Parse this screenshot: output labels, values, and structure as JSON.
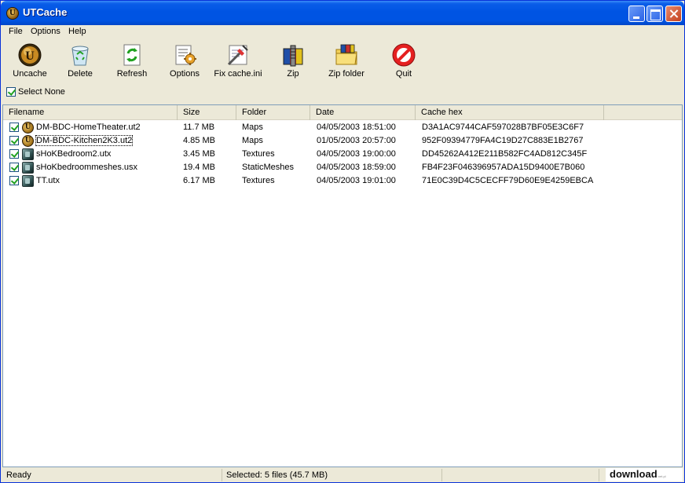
{
  "window": {
    "title": "UTCache"
  },
  "menu": [
    "File",
    "Options",
    "Help"
  ],
  "toolbar": [
    {
      "label": "Uncache",
      "icon": "uncache-icon"
    },
    {
      "label": "Delete",
      "icon": "recycle-bin-icon"
    },
    {
      "label": "Refresh",
      "icon": "refresh-icon"
    },
    {
      "label": "Options",
      "icon": "options-icon"
    },
    {
      "label": "Fix cache.ini",
      "icon": "fix-cache-icon"
    },
    {
      "label": "Zip",
      "icon": "zip-icon"
    },
    {
      "label": "Zip folder",
      "icon": "zip-folder-icon"
    },
    {
      "label": "Quit",
      "icon": "quit-icon"
    }
  ],
  "select_none": {
    "label": "Select None",
    "checked": true
  },
  "columns": [
    "Filename",
    "Size",
    "Folder",
    "Date",
    "Cache hex"
  ],
  "files": [
    {
      "filename": "DM-BDC-HomeTheater.ut2",
      "size": "11.7 MB",
      "folder": "Maps",
      "date": "04/05/2003 18:51:00",
      "hex": "D3A1AC9744CAF597028B7BF05E3C6F7",
      "type": "map",
      "checked": true
    },
    {
      "filename": "DM-BDC-Kitchen2K3.ut2",
      "size": "4.85 MB",
      "folder": "Maps",
      "date": "01/05/2003 20:57:00",
      "hex": "952F09394779FA4C19D27C883E1B2767",
      "type": "map",
      "checked": true
    },
    {
      "filename": "sHoKBedroom2.utx",
      "size": "3.45 MB",
      "folder": "Textures",
      "date": "04/05/2003 19:00:00",
      "hex": "DD45262A412E211B582FC4AD812C345F",
      "type": "texture",
      "checked": true
    },
    {
      "filename": "sHoKbedroommeshes.usx",
      "size": "19.4 MB",
      "folder": "StaticMeshes",
      "date": "04/05/2003 18:59:00",
      "hex": "FB4F23F046396957ADA15D9400E7B060",
      "type": "mesh",
      "checked": true
    },
    {
      "filename": "TT.utx",
      "size": "6.17 MB",
      "folder": "Textures",
      "date": "04/05/2003 19:01:00",
      "hex": "71E0C39D4C5CECFF79D60E9E4259EBCA",
      "type": "texture",
      "checked": true
    }
  ],
  "status": {
    "left": "Ready",
    "middle": "Selected: 5 files (45.7 MB)"
  },
  "watermark": {
    "main": "download",
    "sub": ".net.pl"
  }
}
